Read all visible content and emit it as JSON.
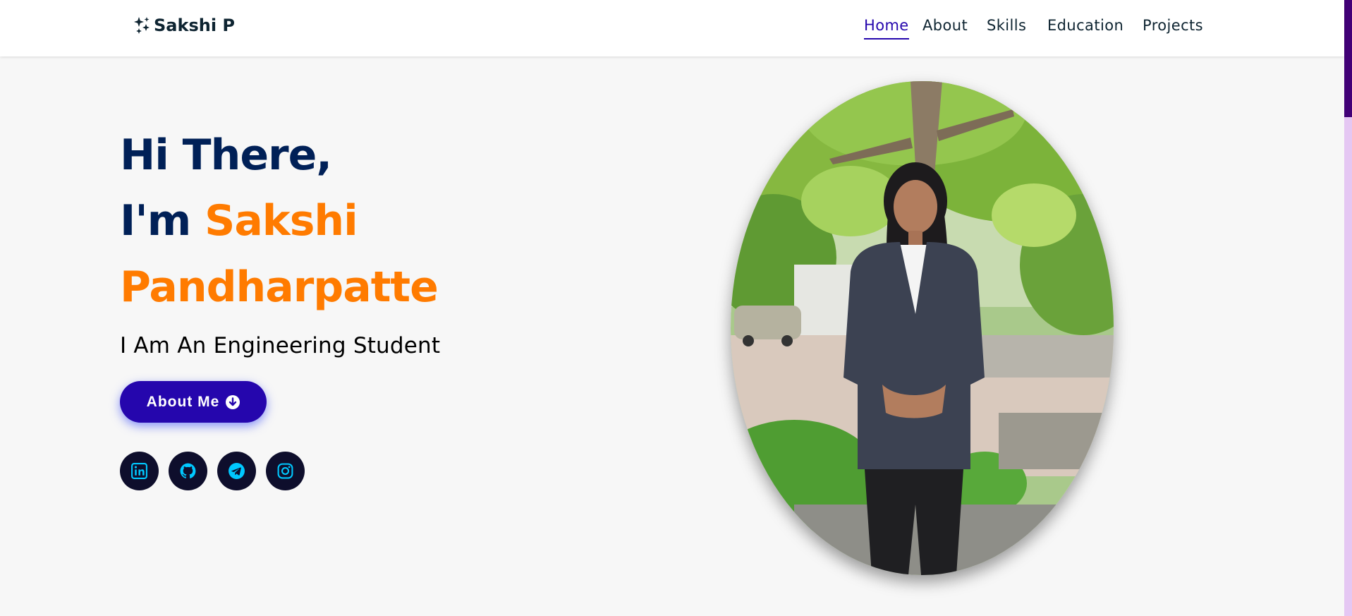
{
  "brand": {
    "name": "Sakshi P",
    "icon": "sparkles-icon"
  },
  "nav": {
    "items": [
      {
        "label": "Home",
        "active": true
      },
      {
        "label": "About",
        "active": false
      },
      {
        "label": "Skills",
        "active": false
      },
      {
        "label": "Education",
        "active": false
      },
      {
        "label": "Projects",
        "active": false
      }
    ]
  },
  "hero": {
    "greeting": "Hi There,",
    "intro_prefix": "I'm",
    "first_name": "Sakshi",
    "last_name": "Pandharpatte",
    "subtitle": "I Am An Engineering Student",
    "button": {
      "label": "About Me",
      "icon": "arrow-circle-down-icon"
    },
    "socials": [
      {
        "name": "linkedin-icon"
      },
      {
        "name": "github-icon"
      },
      {
        "name": "telegram-icon"
      },
      {
        "name": "instagram-icon"
      }
    ]
  },
  "colors": {
    "navy": "#002057",
    "accent": "#ff7b00",
    "primary": "#2506ad",
    "social_bg": "#0e0e2c",
    "social_icon": "#00c8ff",
    "background": "#f7f7f7"
  }
}
